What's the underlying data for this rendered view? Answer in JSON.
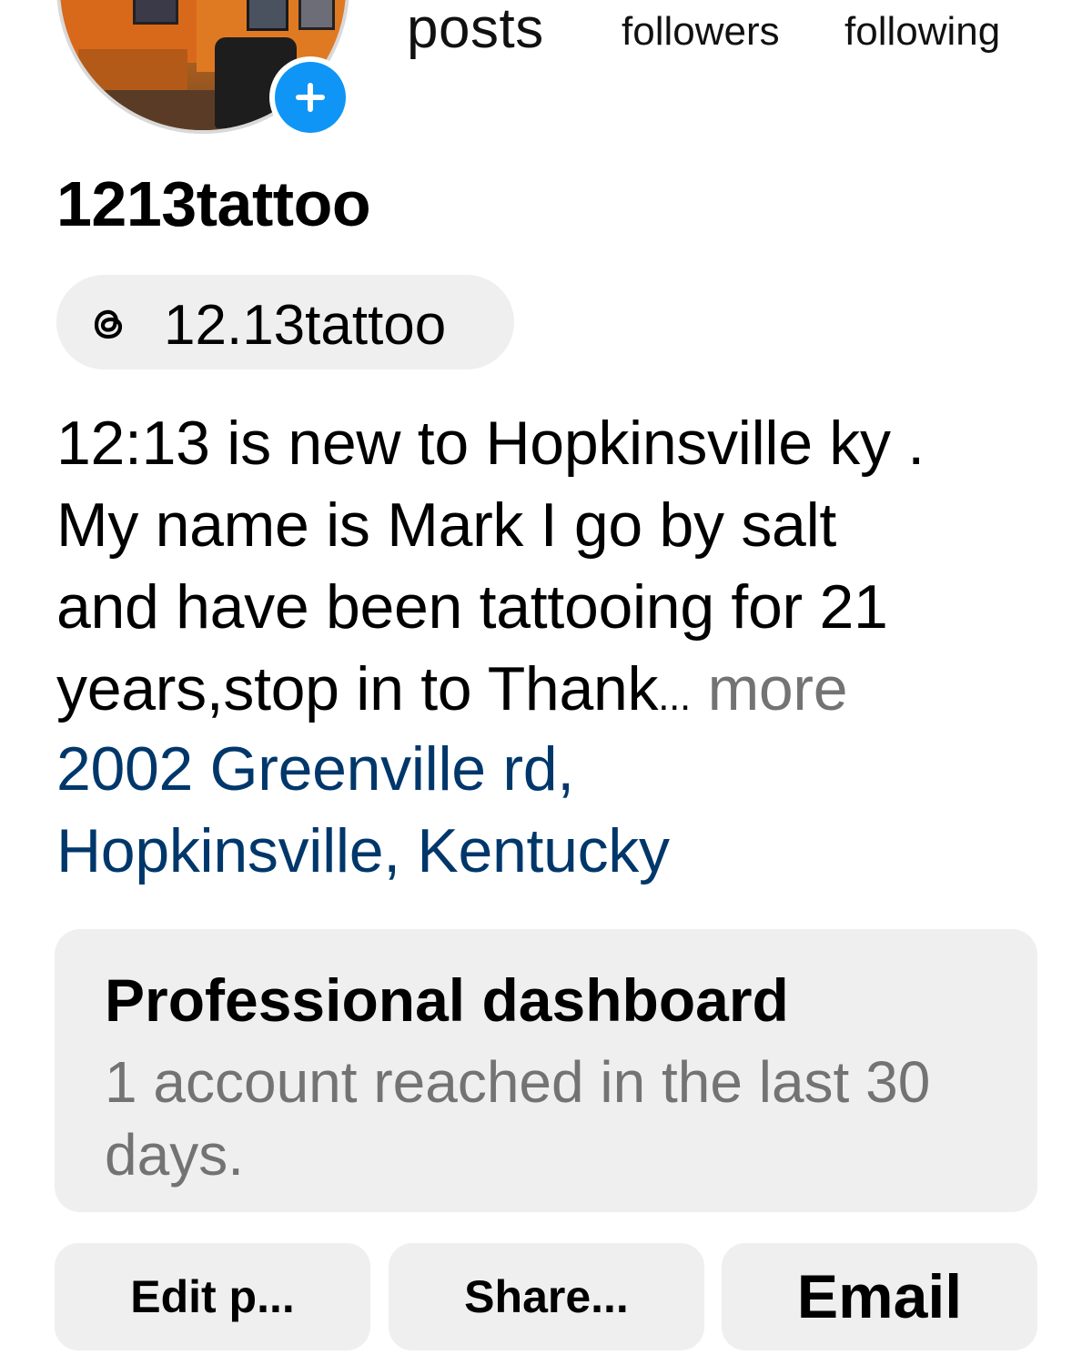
{
  "profile": {
    "username": "1213tattoo",
    "threads_handle": "12.13tattoo",
    "stats": {
      "posts_label": "posts",
      "followers_label": "followers",
      "following_label": "following"
    },
    "bio_lines": [
      "12:13 is new to Hopkinsville ky .",
      "My name is Mark I go by salt",
      "and have been tattooing for 21",
      "years,stop in to Thank"
    ],
    "bio_ellipsis": "...",
    "bio_more": "more",
    "address_lines": [
      "2002 Greenville rd,",
      "Hopkinsville, Kentucky"
    ]
  },
  "dashboard": {
    "title": "Professional dashboard",
    "subtitle": "1 account reached in the last 30 days."
  },
  "buttons": {
    "edit_label": "Edit p...",
    "share_label": "Share...",
    "email_label": "Email"
  },
  "icons": {
    "add_story": "plus-icon",
    "threads": "threads-icon"
  },
  "colors": {
    "link_blue": "#00376b",
    "add_badge_blue": "#0f95f6",
    "muted_text": "#737373",
    "button_bg": "#efefef"
  }
}
